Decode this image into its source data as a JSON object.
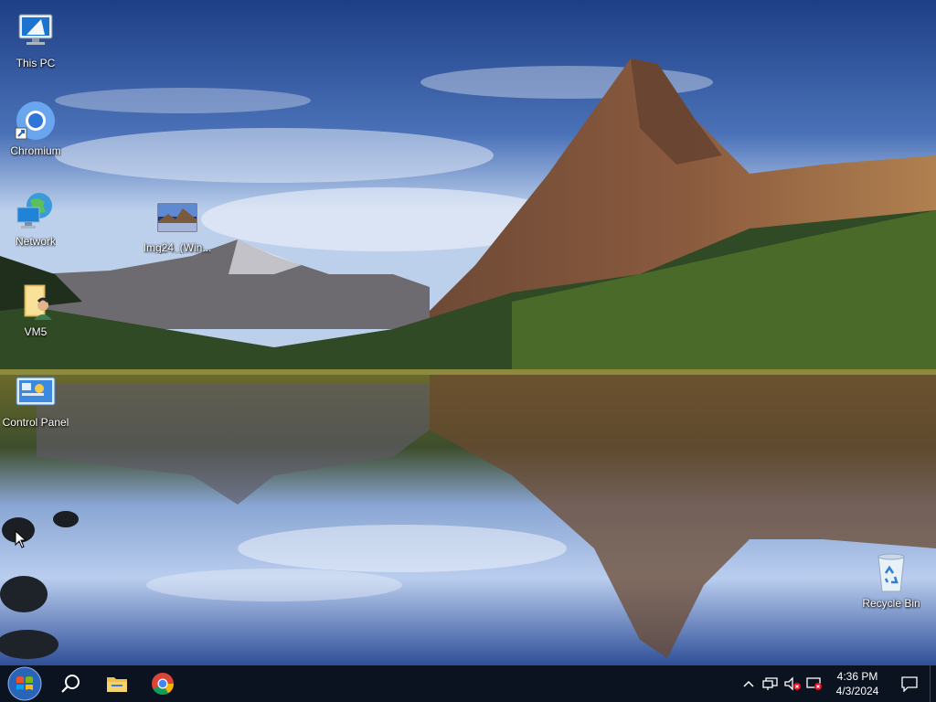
{
  "desktop": {
    "icons": [
      {
        "label": "This PC"
      },
      {
        "label": "Chromium"
      },
      {
        "label": "Network"
      },
      {
        "label": "Img24_(Win..."
      },
      {
        "label": "VM5"
      },
      {
        "label": "Control Panel"
      },
      {
        "label": "Recycle Bin"
      }
    ]
  },
  "taskbar": {
    "clock": {
      "time": "4:36 PM",
      "date": "4/3/2024"
    },
    "pinned": [
      "start-icon",
      "search-icon",
      "file-explorer-icon",
      "chrome-icon"
    ],
    "tray_icons": [
      "chevron-up-icon",
      "network-icon",
      "volume-muted-icon",
      "security-alert-icon"
    ],
    "background_color": "#0b1220"
  }
}
